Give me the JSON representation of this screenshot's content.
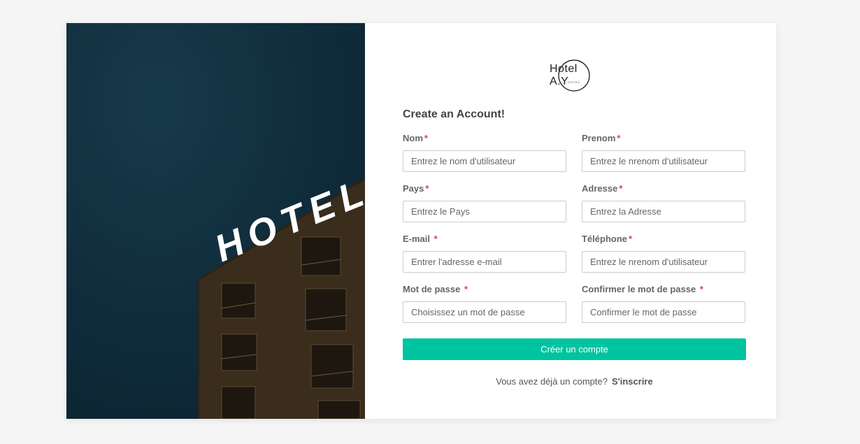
{
  "logo": {
    "name": "Hotel A.Y",
    "sub": "HOTEL"
  },
  "hero": {
    "sign": "HOTEL"
  },
  "form": {
    "title": "Create an Account!",
    "required_mark": "*",
    "fields": [
      {
        "label": "Nom",
        "placeholder": "Entrez le nom d'utilisateur",
        "value": ""
      },
      {
        "label": "Prenom",
        "placeholder": "Entrez le nrenom d'utilisateur",
        "value": ""
      },
      {
        "label": "Pays",
        "placeholder": "Entrez le Pays",
        "value": ""
      },
      {
        "label": "Adresse",
        "placeholder": "Entrez la Adresse",
        "value": ""
      },
      {
        "label": "E-mail ",
        "placeholder": "Entrer l'adresse e-mail",
        "value": ""
      },
      {
        "label": "Téléphone",
        "placeholder": "Entrez le nrenom d'utilisateur",
        "value": ""
      },
      {
        "label": "Mot de passe ",
        "placeholder": "Choisissez un mot de passe",
        "value": ""
      },
      {
        "label": "Confirmer le mot de passe ",
        "placeholder": "Confirmer le mot de passe",
        "value": ""
      }
    ],
    "submit_label": "Créer un compte",
    "footer_text": "Vous avez déjà un compte?",
    "footer_link": "S'inscrire"
  },
  "colors": {
    "accent": "#00c49f",
    "required": "#e53a4a",
    "background": "#f5f5f5"
  }
}
